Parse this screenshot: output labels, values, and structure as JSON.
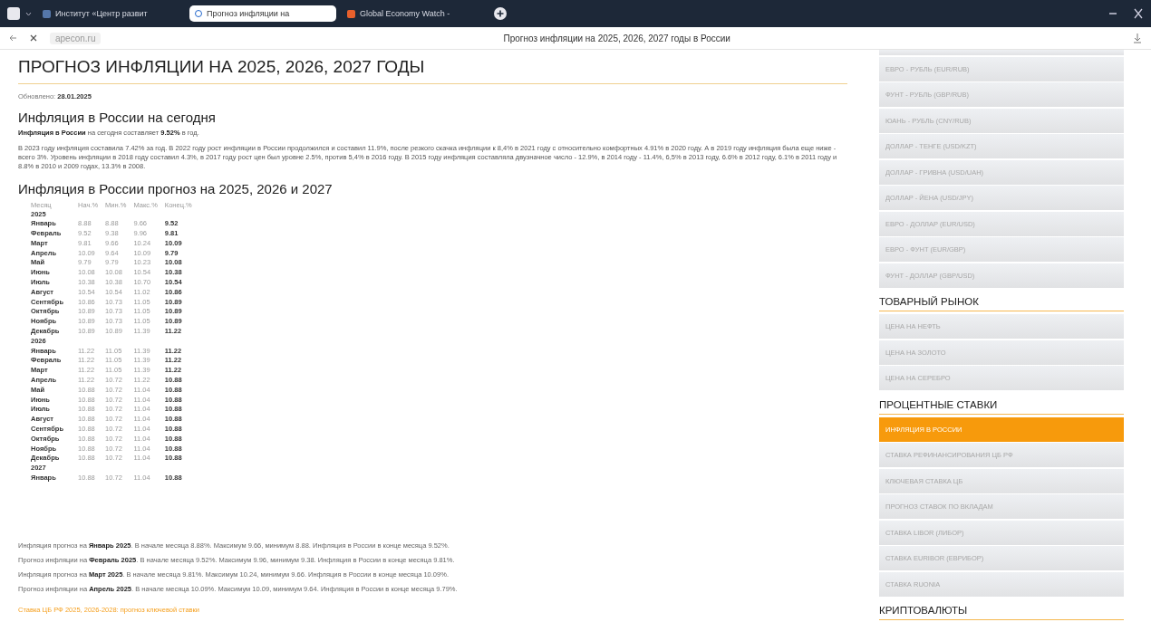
{
  "browser": {
    "tabs": [
      {
        "label": "Институт «Центр развит",
        "selected": false
      },
      {
        "label": "Прогноз инфляции на",
        "selected": true
      },
      {
        "label": "Global Economy Watch -",
        "selected": false
      }
    ],
    "address": "apecon.ru",
    "page_title": "Прогноз инфляции на 2025, 2026, 2027 годы в России"
  },
  "article": {
    "title": "ПРОГНОЗ ИНФЛЯЦИИ НА 2025, 2026, 2027 ГОДЫ",
    "updated_label": "Обновлено:",
    "updated_date": "28.01.2025",
    "section_1_heading": "Инфляция в России на сегодня",
    "summary": "**Инфляция в России** на сегодня составляет **9.52%** в год.",
    "history": "В 2023 году инфляция составила 7.42% за год. В 2022 году рост инфляции в России продолжился и составил 11.9%, после резкого скачка инфляции к 8,4% в 2021 году с относительно комфортных 4.91% в 2020 году. А в 2019 году инфляция была еще ниже - всего 3%. Уровень инфляции в 2018 году составил 4.3%, в 2017 году рост цен был уровне 2.5%, против 5,4% в 2016 году. В 2015 году инфляция составляла двузначное число - 12.9%, в 2014 году - 11.4%, 6,5% в 2013 году, 6.6% в 2012 году, 6.1% в 2011 году и 8.8% в 2010 и 2009 годах, 13.3% в 2008.",
    "section_2_heading": "Инфляция в России прогноз на 2025, 2026 и 2027",
    "table": {
      "columns": [
        "Месяц",
        "Нач.%",
        "Мин.%",
        "Макс.%",
        "Конец.%"
      ],
      "rows": [
        {
          "kind": "year",
          "label": "2025"
        },
        {
          "kind": "month",
          "cells": [
            "Январь",
            "8.88",
            "8.88",
            "9.66",
            "9.52"
          ]
        },
        {
          "kind": "month",
          "cells": [
            "Февраль",
            "9.52",
            "9.38",
            "9.96",
            "9.81"
          ]
        },
        {
          "kind": "month",
          "cells": [
            "Март",
            "9.81",
            "9.66",
            "10.24",
            "10.09"
          ]
        },
        {
          "kind": "month",
          "cells": [
            "Апрель",
            "10.09",
            "9.64",
            "10.09",
            "9.79"
          ]
        },
        {
          "kind": "month",
          "cells": [
            "Май",
            "9.79",
            "9.79",
            "10.23",
            "10.08"
          ]
        },
        {
          "kind": "month",
          "cells": [
            "Июнь",
            "10.08",
            "10.08",
            "10.54",
            "10.38"
          ]
        },
        {
          "kind": "month",
          "cells": [
            "Июль",
            "10.38",
            "10.38",
            "10.70",
            "10.54"
          ]
        },
        {
          "kind": "month",
          "cells": [
            "Август",
            "10.54",
            "10.54",
            "11.02",
            "10.86"
          ]
        },
        {
          "kind": "month",
          "cells": [
            "Сентябрь",
            "10.86",
            "10.73",
            "11.05",
            "10.89"
          ]
        },
        {
          "kind": "month",
          "cells": [
            "Октябрь",
            "10.89",
            "10.73",
            "11.05",
            "10.89"
          ]
        },
        {
          "kind": "month",
          "cells": [
            "Ноябрь",
            "10.89",
            "10.73",
            "11.05",
            "10.89"
          ]
        },
        {
          "kind": "month",
          "cells": [
            "Декабрь",
            "10.89",
            "10.89",
            "11.39",
            "11.22"
          ]
        },
        {
          "kind": "year",
          "label": "2026"
        },
        {
          "kind": "month",
          "cells": [
            "Январь",
            "11.22",
            "11.05",
            "11.39",
            "11.22"
          ]
        },
        {
          "kind": "month",
          "cells": [
            "Февраль",
            "11.22",
            "11.05",
            "11.39",
            "11.22"
          ]
        },
        {
          "kind": "month",
          "cells": [
            "Март",
            "11.22",
            "11.05",
            "11.39",
            "11.22"
          ]
        },
        {
          "kind": "month",
          "cells": [
            "Апрель",
            "11.22",
            "10.72",
            "11.22",
            "10.88"
          ]
        },
        {
          "kind": "month",
          "cells": [
            "Май",
            "10.88",
            "10.72",
            "11.04",
            "10.88"
          ]
        },
        {
          "kind": "month",
          "cells": [
            "Июнь",
            "10.88",
            "10.72",
            "11.04",
            "10.88"
          ]
        },
        {
          "kind": "month",
          "cells": [
            "Июль",
            "10.88",
            "10.72",
            "11.04",
            "10.88"
          ]
        },
        {
          "kind": "month",
          "cells": [
            "Август",
            "10.88",
            "10.72",
            "11.04",
            "10.88"
          ]
        },
        {
          "kind": "month",
          "cells": [
            "Сентябрь",
            "10.88",
            "10.72",
            "11.04",
            "10.88"
          ]
        },
        {
          "kind": "month",
          "cells": [
            "Октябрь",
            "10.88",
            "10.72",
            "11.04",
            "10.88"
          ]
        },
        {
          "kind": "month",
          "cells": [
            "Ноябрь",
            "10.88",
            "10.72",
            "11.04",
            "10.88"
          ]
        },
        {
          "kind": "month",
          "cells": [
            "Декабрь",
            "10.88",
            "10.72",
            "11.04",
            "10.88"
          ]
        },
        {
          "kind": "year",
          "label": "2027"
        },
        {
          "kind": "month",
          "cells": [
            "Январь",
            "10.88",
            "10.72",
            "11.04",
            "10.88"
          ]
        }
      ]
    },
    "forecast_lines": [
      "Инфляция прогноз на **Январь 2025**. В начале месяца 8.88%. Максимум 9.66, минимум 8.88. Инфляция в России в конце месяца 9.52%.",
      "Прогноз инфляции на **Февраль 2025**. В начале месяца 9.52%. Максимум 9.96, минимум 9.38. Инфляция в России в конце месяца 9.81%.",
      "Инфляция прогноз на **Март 2025**. В начале месяца 9.81%. Максимум 10.24, минимум 9.66. Инфляция в России в конце месяца 10.09%.",
      "Прогноз инфляции на **Апрель 2025**. В начале месяца 10.09%. Максимум 10.09, минимум 9.64. Инфляция в России в конце месяца 9.79%."
    ],
    "related_link": "Ставка ЦБ РФ 2025, 2026-2028: прогноз ключевой ставки"
  },
  "sidebar": {
    "groups": [
      {
        "items": [
          {
            "label": "ЕВРО - РУБЛЬ (EUR/RUB)",
            "selected": false
          },
          {
            "label": "ФУНТ - РУБЛЬ (GBP/RUB)",
            "selected": false
          },
          {
            "label": "ЮАНЬ - РУБЛЬ (CNY/RUB)",
            "selected": false
          },
          {
            "label": "ДОЛЛАР - ТЕНГЕ (USD/KZT)",
            "selected": false
          },
          {
            "label": "ДОЛЛАР - ГРИВНА (USD/UAH)",
            "selected": false
          },
          {
            "label": "ДОЛЛАР - ЙЕНА (USD/JPY)",
            "selected": false
          },
          {
            "label": "ЕВРО - ДОЛЛАР (EUR/USD)",
            "selected": false
          },
          {
            "label": "ЕВРО - ФУНТ (EUR/GBP)",
            "selected": false
          },
          {
            "label": "ФУНТ - ДОЛЛАР (GBP/USD)",
            "selected": false
          }
        ]
      },
      {
        "heading": "ТОВАРНЫЙ РЫНОК",
        "items": [
          {
            "label": "ЦЕНА НА НЕФТЬ",
            "selected": false
          },
          {
            "label": "ЦЕНА НА ЗОЛОТО",
            "selected": false
          },
          {
            "label": "ЦЕНА НА СЕРЕБРО",
            "selected": false
          }
        ]
      },
      {
        "heading": "ПРОЦЕНТНЫЕ СТАВКИ",
        "items": [
          {
            "label": "ИНФЛЯЦИЯ В РОССИИ",
            "selected": true
          },
          {
            "label": "СТАВКА РЕФИНАНСИРОВАНИЯ ЦБ РФ",
            "selected": false
          },
          {
            "label": "КЛЮЧЕВАЯ СТАВКА ЦБ",
            "selected": false
          },
          {
            "label": "ПРОГНОЗ СТАВОК ПО ВКЛАДАМ",
            "selected": false
          },
          {
            "label": "СТАВКА LIBOR (ЛИБОР)",
            "selected": false
          },
          {
            "label": "СТАВКА EURIBOR (ЕВРИБОР)",
            "selected": false
          },
          {
            "label": "СТАВКА RUONIA",
            "selected": false
          }
        ]
      },
      {
        "heading": "КРИПТОВАЛЮТЫ"
      }
    ]
  }
}
